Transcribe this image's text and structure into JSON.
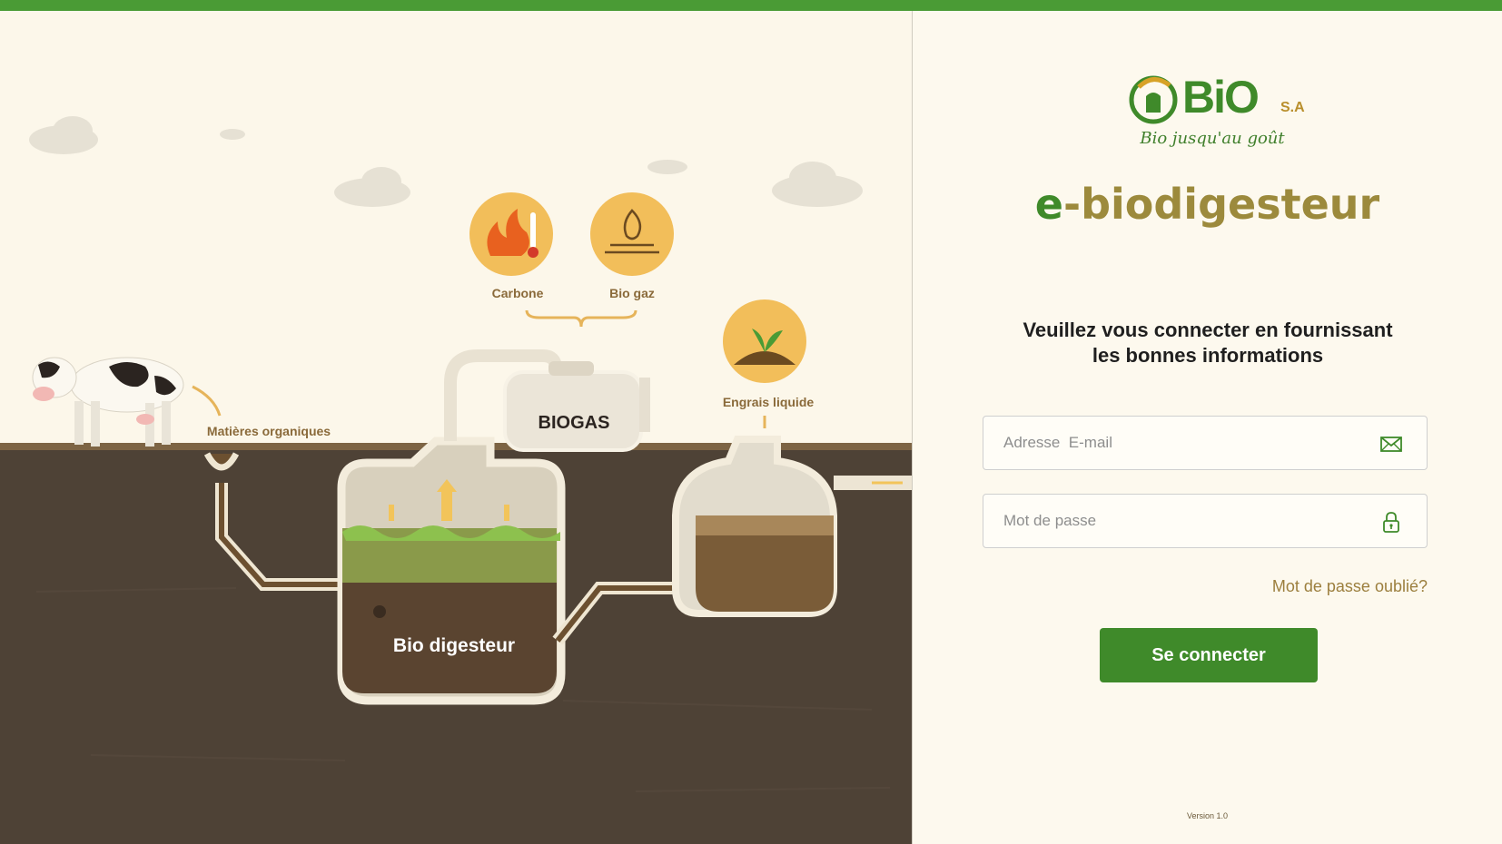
{
  "brand": {
    "logo_word": "BiO",
    "logo_suffix": "S.A",
    "tagline": "Bio jusqu'au goût",
    "app_title_prefix": "e",
    "app_title_rest": "-biodigesteur"
  },
  "login": {
    "instructions_line1": "Veuillez vous connecter en fournissant",
    "instructions_line2": "les bonnes informations",
    "email_placeholder": "Adresse  E-mail",
    "password_placeholder": "Mot de passe",
    "forgot_label": "Mot de passe oublié?",
    "submit_label": "Se connecter",
    "version": "Version 1.0"
  },
  "illustration": {
    "carbone": "Carbone",
    "biogaz": "Bio gaz",
    "engrais": "Engrais liquide",
    "matieres": "Matières organiques",
    "biogas_tank": "BIOGAS",
    "digester": "Bio digesteur"
  },
  "colors": {
    "brand_green": "#3f8a2a",
    "brand_gold": "#9c8a3c",
    "soil": "#4e4236",
    "background": "#fdf9ee"
  },
  "icons": {
    "email": "envelope-icon",
    "password": "lock-icon"
  }
}
